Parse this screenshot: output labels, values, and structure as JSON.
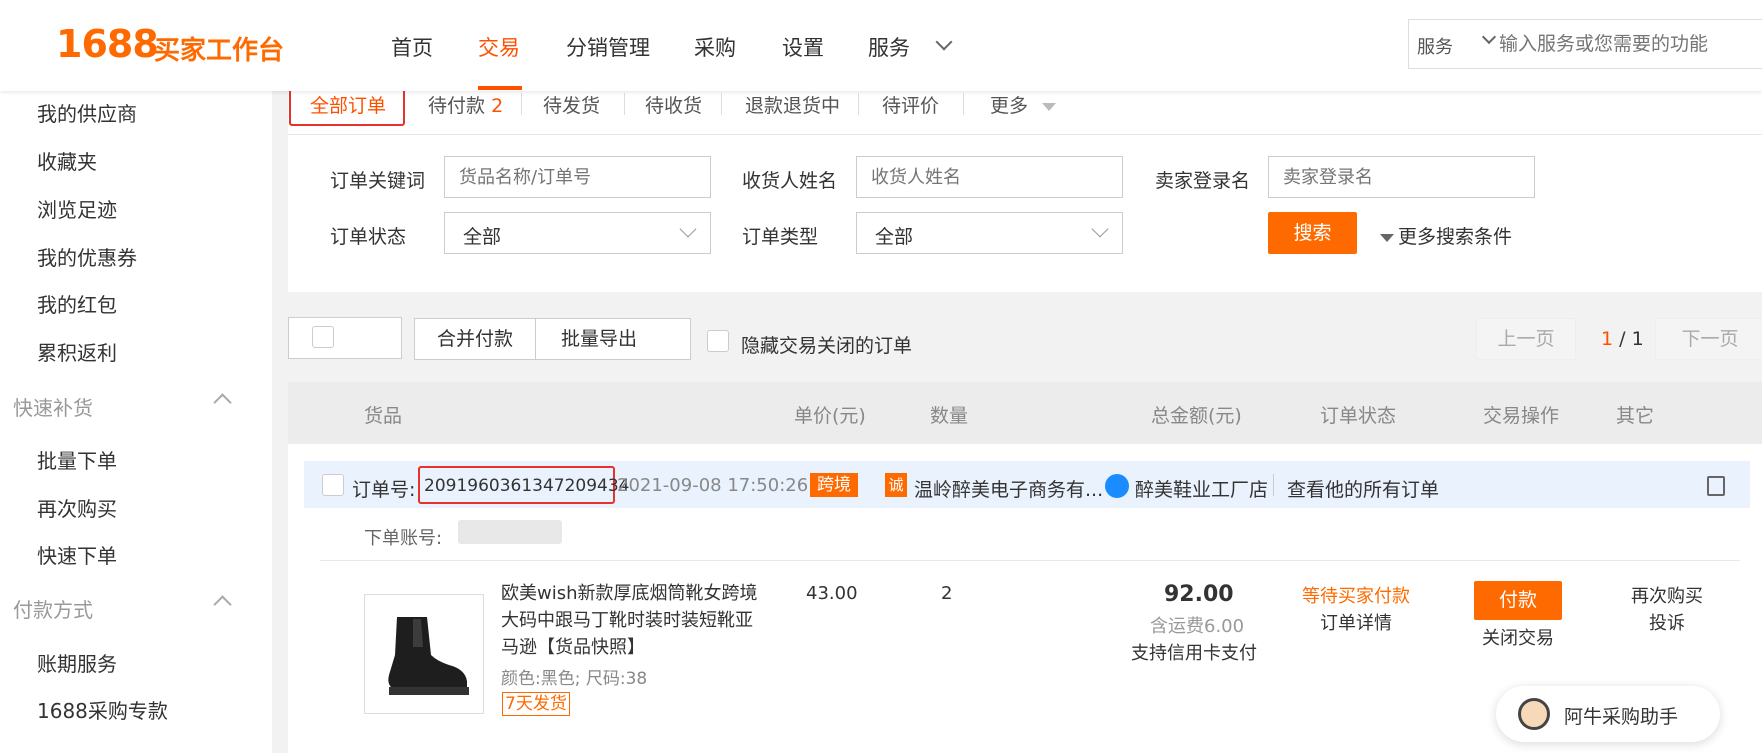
{
  "header": {
    "logo_num": "1688",
    "logo_text": "买家工作台",
    "nav": [
      "首页",
      "交易",
      "分销管理",
      "采购",
      "设置",
      "服务"
    ],
    "active_nav": "交易",
    "search_category": "服务",
    "search_placeholder": "输入服务或您需要的功能"
  },
  "sidebar": {
    "items_top": [
      "我的供应商",
      "收藏夹",
      "浏览足迹",
      "我的优惠券",
      "我的红包",
      "累积返利"
    ],
    "section_quick": "快速补货",
    "items_quick": [
      "批量下单",
      "再次购买",
      "快速下单"
    ],
    "section_pay": "付款方式",
    "items_pay": [
      "账期服务",
      "1688采购专款"
    ]
  },
  "tabs": {
    "all": "全部订单",
    "pending_pay": "待付款",
    "pending_pay_count": "2",
    "pending_ship": "待发货",
    "pending_receive": "待收货",
    "refund": "退款退货中",
    "pending_review": "待评价",
    "more": "更多"
  },
  "filters": {
    "keyword_label": "订单关键词",
    "keyword_placeholder": "货品名称/订单号",
    "receiver_label": "收货人姓名",
    "receiver_placeholder": "收货人姓名",
    "seller_label": "卖家登录名",
    "seller_placeholder": "卖家登录名",
    "status_label": "订单状态",
    "status_value": "全部",
    "type_label": "订单类型",
    "type_value": "全部",
    "search_button": "搜索",
    "more_conditions": "更多搜索条件"
  },
  "toolbar": {
    "merge_pay": "合并付款",
    "batch_export": "批量导出",
    "hide_closed": "隐藏交易关闭的订单",
    "prev_page": "上一页",
    "current_page": "1",
    "page_sep": "/",
    "total_pages": "1",
    "next_page": "下一页"
  },
  "table_headers": [
    "货品",
    "单价(元)",
    "数量",
    "总金额(元)",
    "订单状态",
    "交易操作",
    "其它"
  ],
  "order": {
    "order_no_label": "订单号:",
    "order_no": "2091960361347209434",
    "time": "2021-09-08 17:50:26",
    "cross_border_badge": "跨境",
    "company_badge": "诚",
    "company": "温岭醉美电子商务有...",
    "shop": "醉美鞋业工厂店",
    "view_all": "查看他的所有订单",
    "account_label": "下单账号:",
    "product_title": "欧美wish新款厚底烟筒靴女跨境大码中跟马丁靴时装时装短靴亚马逊",
    "snapshot": "【货品快照】",
    "attrs": "颜色:黑色;  尺码:38",
    "ship_badge": "7天发货",
    "unit_price": "43.00",
    "quantity": "2",
    "total": "92.00",
    "shipping": "含运费6.00",
    "credit": "支持信用卡支付",
    "status": "等待买家付款",
    "detail": "订单详情",
    "pay_button": "付款",
    "close": "关闭交易",
    "rebuy": "再次购买",
    "complain": "投诉"
  },
  "assistant": {
    "label": "阿牛采购助手"
  },
  "colors": {
    "brand": "#ff6a00",
    "active": "#ff5000",
    "highlight_box": "#e5322d",
    "order_header_bg": "#eaf2fd"
  }
}
